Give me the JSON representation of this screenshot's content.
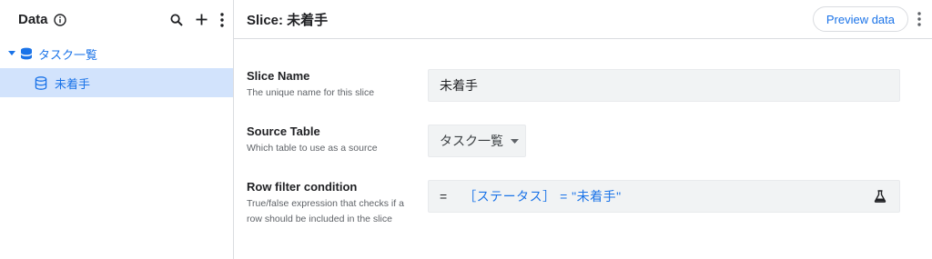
{
  "sidebar": {
    "title": "Data",
    "tree": {
      "root_label": "タスク一覧",
      "child_label": "未着手"
    }
  },
  "main": {
    "title": "Slice: 未着手",
    "preview_label": "Preview data",
    "fields": {
      "slice_name": {
        "label": "Slice Name",
        "description": "The unique name for this slice",
        "value": "未着手"
      },
      "source_table": {
        "label": "Source Table",
        "description": "Which table to use as a source",
        "value": "タスク一覧"
      },
      "row_filter": {
        "label": "Row filter condition",
        "description": "True/false expression that checks if a row should be included in the slice",
        "prefix": "=",
        "expression": "［ステータス］ = \"未着手\""
      }
    }
  },
  "colors": {
    "accent": "#1a73e8",
    "selected_bg": "#d2e3fc",
    "field_bg": "#f1f3f4",
    "border": "#dadce0"
  },
  "icons": [
    "info-icon",
    "search-icon",
    "plus-icon",
    "more-vert-icon",
    "caret-down-icon",
    "database-icon",
    "flask-icon"
  ]
}
